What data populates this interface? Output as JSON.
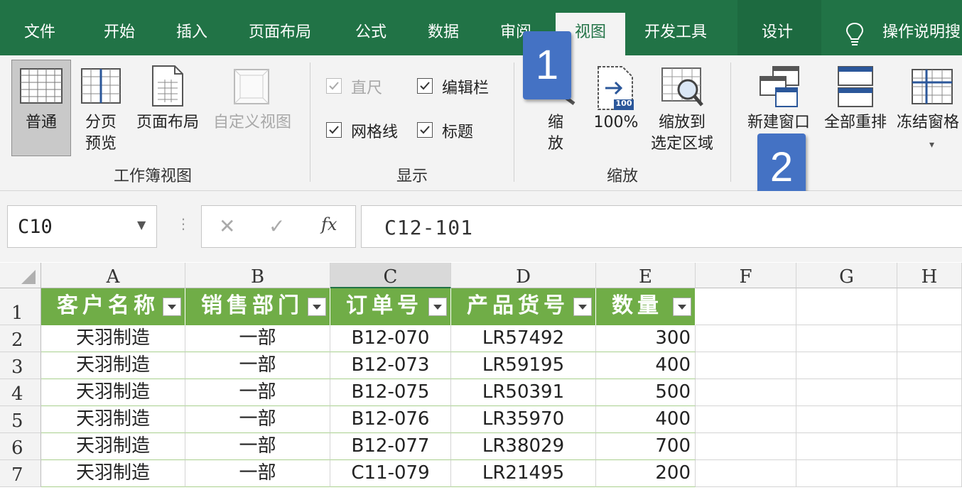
{
  "tabs": [
    "文件",
    "开始",
    "插入",
    "页面布局",
    "公式",
    "数据",
    "审阅",
    "视图",
    "开发工具",
    "设计"
  ],
  "active_tab": "视图",
  "tell_me": "操作说明搜",
  "ribbon": {
    "workbook_views": {
      "group_label": "工作簿视图",
      "normal": "普通",
      "page_break_1": "分页",
      "page_break_2": "预览",
      "page_layout": "页面布局",
      "custom_views": "自定义视图"
    },
    "show": {
      "group_label": "显示",
      "ruler": "直尺",
      "formula_bar": "编辑栏",
      "gridlines": "网格线",
      "headings": "标题",
      "checked": {
        "ruler": true,
        "formula_bar": true,
        "gridlines": true,
        "headings": true
      }
    },
    "zoom": {
      "group_label": "缩放",
      "zoom_1": "缩",
      "zoom_2": "放",
      "hundred": "100%",
      "hundred_icon": "100",
      "zoom_sel_1": "缩放到",
      "zoom_sel_2": "选定区域"
    },
    "window": {
      "new_window": "新建窗口",
      "arrange_all": "全部重排",
      "freeze": "冻结窗格"
    }
  },
  "callouts": {
    "one": "1",
    "two": "2"
  },
  "formula_bar": {
    "name_box": "C10",
    "formula": "C12-101",
    "fx": "fx"
  },
  "columns": [
    "A",
    "B",
    "C",
    "D",
    "E",
    "F",
    "G",
    "H"
  ],
  "selected_column": "C",
  "rows": [
    "1",
    "2",
    "3",
    "4",
    "5",
    "6",
    "7"
  ],
  "table": {
    "headers": [
      "客户名称",
      "销售部门",
      "订单号",
      "产品货号",
      "数量"
    ],
    "data": [
      [
        "天羽制造",
        "一部",
        "B12-070",
        "LR57492",
        "300"
      ],
      [
        "天羽制造",
        "一部",
        "B12-073",
        "LR59195",
        "400"
      ],
      [
        "天羽制造",
        "一部",
        "B12-075",
        "LR50391",
        "500"
      ],
      [
        "天羽制造",
        "一部",
        "B12-076",
        "LR35970",
        "400"
      ],
      [
        "天羽制造",
        "一部",
        "B12-077",
        "LR38029",
        "700"
      ],
      [
        "天羽制造",
        "一部",
        "C11-079",
        "LR21495",
        "200"
      ]
    ]
  },
  "colors": {
    "accent": "#217346",
    "table_header": "#70ad47",
    "callout": "#4472c4"
  }
}
